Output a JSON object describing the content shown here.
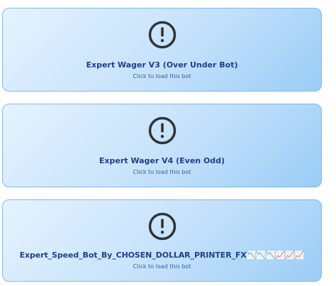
{
  "bots": [
    {
      "title": "Expert Wager V3 (Over Under Bot)",
      "subtitle": "Click to load this bot",
      "icon": "alert-circle-icon"
    },
    {
      "title": "Expert Wager V4 (Even Odd)",
      "subtitle": "Click to load this bot",
      "icon": "alert-circle-icon"
    },
    {
      "title": "Expert_Speed_Bot_By_CHOSEN_DOLLAR_PRINTER_FX📉📉📉📈📈📈",
      "subtitle": "Click to load this bot",
      "icon": "alert-circle-icon"
    }
  ],
  "colors": {
    "title": "#1f3f8a",
    "subtitle": "#3a5d94",
    "icon": "#333333",
    "card_border": "#7fb9ec"
  }
}
